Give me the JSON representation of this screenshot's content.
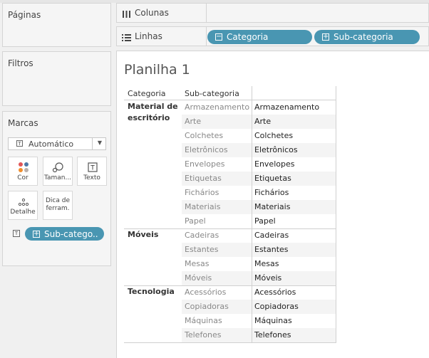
{
  "panels": {
    "paginas": "Páginas",
    "filtros": "Filtros",
    "marcas": "Marcas"
  },
  "marks": {
    "type": "Automático",
    "buttons": [
      {
        "label": "Cor",
        "icon": "color-dots-icon"
      },
      {
        "label": "Taman...",
        "icon": "size-icon"
      },
      {
        "label": "Texto",
        "icon": "text-icon"
      },
      {
        "label": "Detalhe",
        "icon": "detail-dots-icon"
      },
      {
        "label": "Dica de ferram.",
        "icon": "tooltip-icon"
      }
    ],
    "field_pill": "Sub-catego.."
  },
  "shelves": {
    "colunas": "Colunas",
    "linhas": "Linhas",
    "linhas_pills": [
      "Categoria",
      "Sub-categoria"
    ]
  },
  "colors": {
    "pill": "#4996b2",
    "band": "#f4f4f4"
  },
  "sheet": {
    "title": "Planilha 1",
    "headers": [
      "Categoria",
      "Sub-categoria"
    ],
    "groups": [
      {
        "category": "Material de escritório",
        "items": [
          "Armazenamento",
          "Arte",
          "Colchetes",
          "Eletrônicos",
          "Envelopes",
          "Etiquetas",
          "Fichários",
          "Materiais",
          "Papel"
        ]
      },
      {
        "category": "Móveis",
        "items": [
          "Cadeiras",
          "Estantes",
          "Mesas",
          "Móveis"
        ]
      },
      {
        "category": "Tecnologia",
        "items": [
          "Acessórios",
          "Copiadoras",
          "Máquinas",
          "Telefones"
        ]
      }
    ]
  }
}
